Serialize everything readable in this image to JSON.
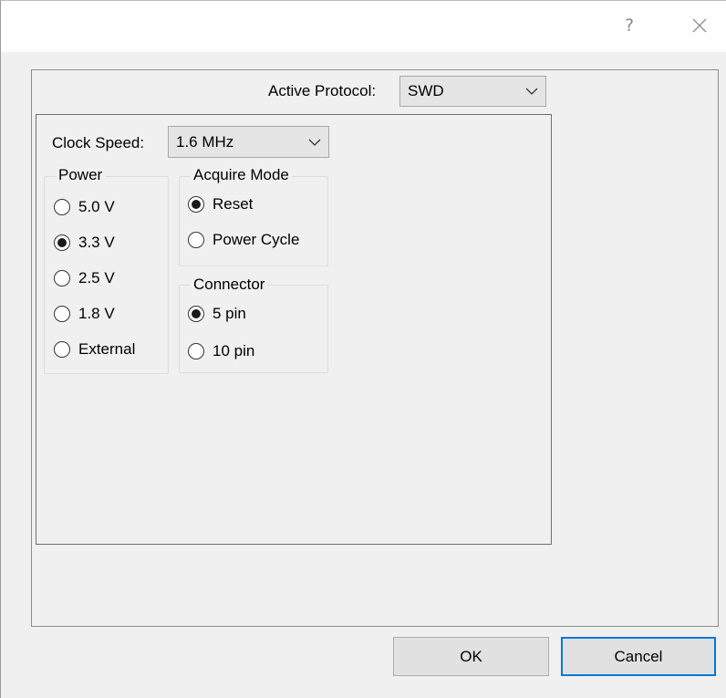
{
  "titlebar": {
    "help_label": "?",
    "close_icon": "close-icon"
  },
  "protocol": {
    "label": "Active Protocol:",
    "value": "SWD"
  },
  "clock": {
    "label": "Clock Speed:",
    "value": "1.6 MHz"
  },
  "power": {
    "title": "Power",
    "options": [
      {
        "label": "5.0 V",
        "checked": false
      },
      {
        "label": "3.3 V",
        "checked": true
      },
      {
        "label": "2.5 V",
        "checked": false
      },
      {
        "label": "1.8 V",
        "checked": false
      },
      {
        "label": "External",
        "checked": false
      }
    ]
  },
  "acquire": {
    "title": "Acquire Mode",
    "options": [
      {
        "label": "Reset",
        "checked": true
      },
      {
        "label": "Power Cycle",
        "checked": false
      }
    ]
  },
  "connector": {
    "title": "Connector",
    "options": [
      {
        "label": "5 pin",
        "checked": true
      },
      {
        "label": "10 pin",
        "checked": false
      }
    ]
  },
  "buttons": {
    "ok": "OK",
    "cancel": "Cancel"
  },
  "colors": {
    "focus_border": "#0078d7",
    "window_bg": "#f0f0f0"
  }
}
